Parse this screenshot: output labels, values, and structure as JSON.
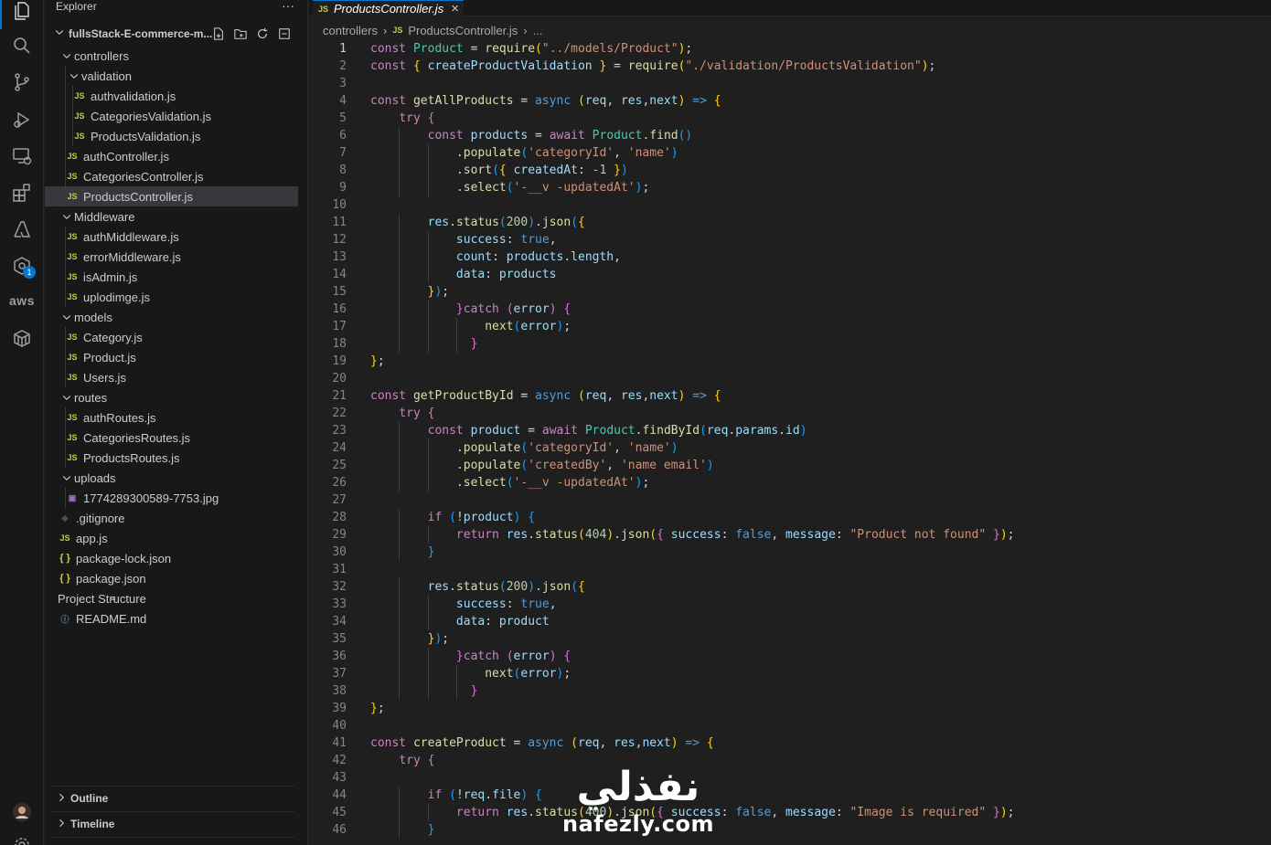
{
  "sidebar": {
    "title": "Explorer",
    "more": "···",
    "project": "fullsStack-E-commerce-m...",
    "tree": [
      {
        "label": "controllers",
        "type": "folder",
        "depth": 1
      },
      {
        "label": "validation",
        "type": "folder",
        "depth": 2
      },
      {
        "label": "authvalidation.js",
        "type": "js",
        "depth": 3
      },
      {
        "label": "CategoriesValidation.js",
        "type": "js",
        "depth": 3
      },
      {
        "label": "ProductsValidation.js",
        "type": "js",
        "depth": 3
      },
      {
        "label": "authController.js",
        "type": "js",
        "depth": 2
      },
      {
        "label": "CategoriesController.js",
        "type": "js",
        "depth": 2
      },
      {
        "label": "ProductsController.js",
        "type": "js",
        "depth": 2,
        "selected": true
      },
      {
        "label": "Middleware",
        "type": "folder",
        "depth": 1
      },
      {
        "label": "authMiddleware.js",
        "type": "js",
        "depth": 2
      },
      {
        "label": "errorMiddleware.js",
        "type": "js",
        "depth": 2
      },
      {
        "label": "isAdmin.js",
        "type": "js",
        "depth": 2
      },
      {
        "label": "uplodimge.js",
        "type": "js",
        "depth": 2
      },
      {
        "label": "models",
        "type": "folder",
        "depth": 1
      },
      {
        "label": "Category.js",
        "type": "js",
        "depth": 2
      },
      {
        "label": "Product.js",
        "type": "js",
        "depth": 2
      },
      {
        "label": "Users.js",
        "type": "js",
        "depth": 2
      },
      {
        "label": "routes",
        "type": "folder",
        "depth": 1
      },
      {
        "label": "authRoutes.js",
        "type": "js",
        "depth": 2
      },
      {
        "label": "CategoriesRoutes.js",
        "type": "js",
        "depth": 2
      },
      {
        "label": "ProductsRoutes.js",
        "type": "js",
        "depth": 2
      },
      {
        "label": "uploads",
        "type": "folder",
        "depth": 1
      },
      {
        "label": "1774289300589-7753.jpg",
        "type": "img",
        "depth": 2
      },
      {
        "label": ".gitignore",
        "type": "git",
        "depth": 1
      },
      {
        "label": "app.js",
        "type": "js",
        "depth": 1
      },
      {
        "label": "package-lock.json",
        "type": "json",
        "depth": 1
      },
      {
        "label": "package.json",
        "type": "json",
        "depth": 1
      },
      {
        "label": "Project Structure",
        "type": "txt",
        "depth": 1
      },
      {
        "label": "README.md",
        "type": "md",
        "depth": 1
      }
    ],
    "outline": "Outline",
    "timeline": "Timeline"
  },
  "activity": {
    "icons": [
      "files-icon",
      "search-icon",
      "source-control-icon",
      "run-debug-icon",
      "remote-explorer-icon",
      "extensions-icon",
      "azure-icon",
      "docker-icon",
      "aws-icon",
      "database-icon"
    ],
    "aws_label": "aws",
    "badge": "1"
  },
  "editor": {
    "tab_label": "ProductsController.js",
    "js_badge": "JS",
    "breadcrumb": [
      "controllers",
      "ProductsController.js",
      "..."
    ]
  },
  "code": {
    "current_line": 1,
    "lines": [
      [
        [
          "c",
          "const "
        ],
        [
          "cls",
          "Product"
        ],
        [
          "p",
          " = "
        ],
        [
          "f",
          "require"
        ],
        [
          "b1",
          "("
        ],
        [
          "s",
          "\"../models/Product\""
        ],
        [
          "b1",
          ")"
        ],
        [
          "p",
          ";"
        ]
      ],
      [
        [
          "c",
          "const "
        ],
        [
          "b1",
          "{ "
        ],
        [
          "v",
          "createProductValidation"
        ],
        [
          "b1",
          " }"
        ],
        [
          "p",
          " = "
        ],
        [
          "f",
          "require"
        ],
        [
          "b1",
          "("
        ],
        [
          "s",
          "\"./validation/ProductsValidation\""
        ],
        [
          "b1",
          ")"
        ],
        [
          "p",
          ";"
        ]
      ],
      [],
      [
        [
          "c",
          "const "
        ],
        [
          "f",
          "getAllProducts"
        ],
        [
          "p",
          " = "
        ],
        [
          "k",
          "async "
        ],
        [
          "b1",
          "("
        ],
        [
          "v",
          "req"
        ],
        [
          "p",
          ", "
        ],
        [
          "v",
          "res"
        ],
        [
          "p",
          ","
        ],
        [
          "v",
          "next"
        ],
        [
          "b1",
          ")"
        ],
        [
          "k",
          " => "
        ],
        [
          "b1",
          "{"
        ]
      ],
      [
        [
          "p",
          "    "
        ],
        [
          "c",
          "try "
        ],
        [
          "b2",
          "{"
        ]
      ],
      [
        [
          "p",
          "        "
        ],
        [
          "c",
          "const "
        ],
        [
          "v",
          "products"
        ],
        [
          "p",
          " = "
        ],
        [
          "c",
          "await "
        ],
        [
          "cls",
          "Product"
        ],
        [
          "p",
          "."
        ],
        [
          "f",
          "find"
        ],
        [
          "b3",
          "()"
        ]
      ],
      [
        [
          "p",
          "            ."
        ],
        [
          "f",
          "populate"
        ],
        [
          "b3",
          "("
        ],
        [
          "s",
          "'categoryId'"
        ],
        [
          "p",
          ", "
        ],
        [
          "s",
          "'name'"
        ],
        [
          "b3",
          ")"
        ]
      ],
      [
        [
          "p",
          "            ."
        ],
        [
          "f",
          "sort"
        ],
        [
          "b3",
          "("
        ],
        [
          "b1",
          "{ "
        ],
        [
          "v",
          "createdAt"
        ],
        [
          "p",
          ": "
        ],
        [
          "n",
          "-1"
        ],
        [
          "b1",
          " }"
        ],
        [
          "b3",
          ")"
        ]
      ],
      [
        [
          "p",
          "            ."
        ],
        [
          "f",
          "select"
        ],
        [
          "b3",
          "("
        ],
        [
          "s",
          "'-__v -updatedAt'"
        ],
        [
          "b3",
          ")"
        ],
        [
          "p",
          ";"
        ]
      ],
      [],
      [
        [
          "p",
          "        "
        ],
        [
          "v",
          "res"
        ],
        [
          "p",
          "."
        ],
        [
          "f",
          "status"
        ],
        [
          "b3",
          "("
        ],
        [
          "n",
          "200"
        ],
        [
          "b3",
          ")"
        ],
        [
          "p",
          "."
        ],
        [
          "f",
          "json"
        ],
        [
          "b3",
          "("
        ],
        [
          "b1",
          "{"
        ]
      ],
      [
        [
          "p",
          "            "
        ],
        [
          "v",
          "success"
        ],
        [
          "p",
          ": "
        ],
        [
          "k",
          "true"
        ],
        [
          "p",
          ","
        ]
      ],
      [
        [
          "p",
          "            "
        ],
        [
          "v",
          "count"
        ],
        [
          "p",
          ": "
        ],
        [
          "v",
          "products"
        ],
        [
          "p",
          "."
        ],
        [
          "v",
          "length"
        ],
        [
          "p",
          ","
        ]
      ],
      [
        [
          "p",
          "            "
        ],
        [
          "v",
          "data"
        ],
        [
          "p",
          ": "
        ],
        [
          "v",
          "products"
        ]
      ],
      [
        [
          "p",
          "        "
        ],
        [
          "b1",
          "}"
        ],
        [
          "b3",
          ")"
        ],
        [
          "p",
          ";"
        ]
      ],
      [
        [
          "p",
          "            "
        ],
        [
          "b2",
          "}"
        ],
        [
          "c",
          "catch "
        ],
        [
          "b2",
          "("
        ],
        [
          "v",
          "error"
        ],
        [
          "b2",
          ")"
        ],
        [
          "p",
          " "
        ],
        [
          "b2",
          "{"
        ]
      ],
      [
        [
          "p",
          "                "
        ],
        [
          "f",
          "next"
        ],
        [
          "b3",
          "("
        ],
        [
          "v",
          "error"
        ],
        [
          "b3",
          ")"
        ],
        [
          "p",
          ";"
        ]
      ],
      [
        [
          "p",
          "              "
        ],
        [
          "b2",
          "}"
        ]
      ],
      [
        [
          "b1",
          "}"
        ],
        [
          "p",
          ";"
        ]
      ],
      [],
      [
        [
          "c",
          "const "
        ],
        [
          "f",
          "getProductById"
        ],
        [
          "p",
          " = "
        ],
        [
          "k",
          "async "
        ],
        [
          "b1",
          "("
        ],
        [
          "v",
          "req"
        ],
        [
          "p",
          ", "
        ],
        [
          "v",
          "res"
        ],
        [
          "p",
          ","
        ],
        [
          "v",
          "next"
        ],
        [
          "b1",
          ")"
        ],
        [
          "k",
          " => "
        ],
        [
          "b1",
          "{"
        ]
      ],
      [
        [
          "p",
          "    "
        ],
        [
          "c",
          "try "
        ],
        [
          "b2",
          "{"
        ]
      ],
      [
        [
          "p",
          "        "
        ],
        [
          "c",
          "const "
        ],
        [
          "v",
          "product"
        ],
        [
          "p",
          " = "
        ],
        [
          "c",
          "await "
        ],
        [
          "cls",
          "Product"
        ],
        [
          "p",
          "."
        ],
        [
          "f",
          "findById"
        ],
        [
          "b3",
          "("
        ],
        [
          "v",
          "req"
        ],
        [
          "p",
          "."
        ],
        [
          "v",
          "params"
        ],
        [
          "p",
          "."
        ],
        [
          "v",
          "id"
        ],
        [
          "b3",
          ")"
        ]
      ],
      [
        [
          "p",
          "            ."
        ],
        [
          "f",
          "populate"
        ],
        [
          "b3",
          "("
        ],
        [
          "s",
          "'categoryId'"
        ],
        [
          "p",
          ", "
        ],
        [
          "s",
          "'name'"
        ],
        [
          "b3",
          ")"
        ]
      ],
      [
        [
          "p",
          "            ."
        ],
        [
          "f",
          "populate"
        ],
        [
          "b3",
          "("
        ],
        [
          "s",
          "'createdBy'"
        ],
        [
          "p",
          ", "
        ],
        [
          "s",
          "'name email'"
        ],
        [
          "b3",
          ")"
        ]
      ],
      [
        [
          "p",
          "            ."
        ],
        [
          "f",
          "select"
        ],
        [
          "b3",
          "("
        ],
        [
          "s",
          "'-__v -updatedAt'"
        ],
        [
          "b3",
          ")"
        ],
        [
          "p",
          ";"
        ]
      ],
      [],
      [
        [
          "p",
          "        "
        ],
        [
          "c",
          "if "
        ],
        [
          "b3",
          "("
        ],
        [
          "p",
          "!"
        ],
        [
          "v",
          "product"
        ],
        [
          "b3",
          ")"
        ],
        [
          "p",
          " "
        ],
        [
          "b3",
          "{"
        ]
      ],
      [
        [
          "p",
          "            "
        ],
        [
          "c",
          "return "
        ],
        [
          "v",
          "res"
        ],
        [
          "p",
          "."
        ],
        [
          "f",
          "status"
        ],
        [
          "b1",
          "("
        ],
        [
          "n",
          "404"
        ],
        [
          "b1",
          ")"
        ],
        [
          "p",
          "."
        ],
        [
          "f",
          "json"
        ],
        [
          "b1",
          "("
        ],
        [
          "b2",
          "{ "
        ],
        [
          "v",
          "success"
        ],
        [
          "p",
          ": "
        ],
        [
          "k",
          "false"
        ],
        [
          "p",
          ", "
        ],
        [
          "v",
          "message"
        ],
        [
          "p",
          ": "
        ],
        [
          "s",
          "\"Product not found\""
        ],
        [
          "b2",
          " }"
        ],
        [
          "b1",
          ")"
        ],
        [
          "p",
          ";"
        ]
      ],
      [
        [
          "p",
          "        "
        ],
        [
          "b3",
          "}"
        ]
      ],
      [],
      [
        [
          "p",
          "        "
        ],
        [
          "v",
          "res"
        ],
        [
          "p",
          "."
        ],
        [
          "f",
          "status"
        ],
        [
          "b3",
          "("
        ],
        [
          "n",
          "200"
        ],
        [
          "b3",
          ")"
        ],
        [
          "p",
          "."
        ],
        [
          "f",
          "json"
        ],
        [
          "b3",
          "("
        ],
        [
          "b1",
          "{"
        ]
      ],
      [
        [
          "p",
          "            "
        ],
        [
          "v",
          "success"
        ],
        [
          "p",
          ": "
        ],
        [
          "k",
          "true"
        ],
        [
          "p",
          ","
        ]
      ],
      [
        [
          "p",
          "            "
        ],
        [
          "v",
          "data"
        ],
        [
          "p",
          ": "
        ],
        [
          "v",
          "product"
        ]
      ],
      [
        [
          "p",
          "        "
        ],
        [
          "b1",
          "}"
        ],
        [
          "b3",
          ")"
        ],
        [
          "p",
          ";"
        ]
      ],
      [
        [
          "p",
          "            "
        ],
        [
          "b2",
          "}"
        ],
        [
          "c",
          "catch "
        ],
        [
          "b2",
          "("
        ],
        [
          "v",
          "error"
        ],
        [
          "b2",
          ")"
        ],
        [
          "p",
          " "
        ],
        [
          "b2",
          "{"
        ]
      ],
      [
        [
          "p",
          "                "
        ],
        [
          "f",
          "next"
        ],
        [
          "b3",
          "("
        ],
        [
          "v",
          "error"
        ],
        [
          "b3",
          ")"
        ],
        [
          "p",
          ";"
        ]
      ],
      [
        [
          "p",
          "              "
        ],
        [
          "b2",
          "}"
        ]
      ],
      [
        [
          "b1",
          "}"
        ],
        [
          "p",
          ";"
        ]
      ],
      [],
      [
        [
          "c",
          "const "
        ],
        [
          "f",
          "createProduct"
        ],
        [
          "p",
          " = "
        ],
        [
          "k",
          "async "
        ],
        [
          "b1",
          "("
        ],
        [
          "v",
          "req"
        ],
        [
          "p",
          ", "
        ],
        [
          "v",
          "res"
        ],
        [
          "p",
          ","
        ],
        [
          "v",
          "next"
        ],
        [
          "b1",
          ")"
        ],
        [
          "k",
          " => "
        ],
        [
          "b1",
          "{"
        ]
      ],
      [
        [
          "p",
          "    "
        ],
        [
          "c",
          "try "
        ],
        [
          "b2",
          "{"
        ]
      ],
      [],
      [
        [
          "p",
          "        "
        ],
        [
          "c",
          "if "
        ],
        [
          "b3",
          "("
        ],
        [
          "p",
          "!"
        ],
        [
          "v",
          "req"
        ],
        [
          "p",
          "."
        ],
        [
          "v",
          "file"
        ],
        [
          "b3",
          ")"
        ],
        [
          "p",
          " "
        ],
        [
          "b3",
          "{"
        ]
      ],
      [
        [
          "p",
          "            "
        ],
        [
          "c",
          "return "
        ],
        [
          "v",
          "res"
        ],
        [
          "p",
          "."
        ],
        [
          "f",
          "status"
        ],
        [
          "b1",
          "("
        ],
        [
          "n",
          "400"
        ],
        [
          "b1",
          ")"
        ],
        [
          "p",
          "."
        ],
        [
          "f",
          "json"
        ],
        [
          "b1",
          "("
        ],
        [
          "b2",
          "{ "
        ],
        [
          "v",
          "success"
        ],
        [
          "p",
          ": "
        ],
        [
          "k",
          "false"
        ],
        [
          "p",
          ", "
        ],
        [
          "v",
          "message"
        ],
        [
          "p",
          ": "
        ],
        [
          "s",
          "\"Image is required\""
        ],
        [
          "b2",
          " }"
        ],
        [
          "b1",
          ")"
        ],
        [
          "p",
          ";"
        ]
      ],
      [
        [
          "p",
          "        "
        ],
        [
          "b3",
          "}"
        ]
      ]
    ]
  },
  "watermark": {
    "arabic": "نفذلي",
    "latin": "nafezly.com"
  }
}
